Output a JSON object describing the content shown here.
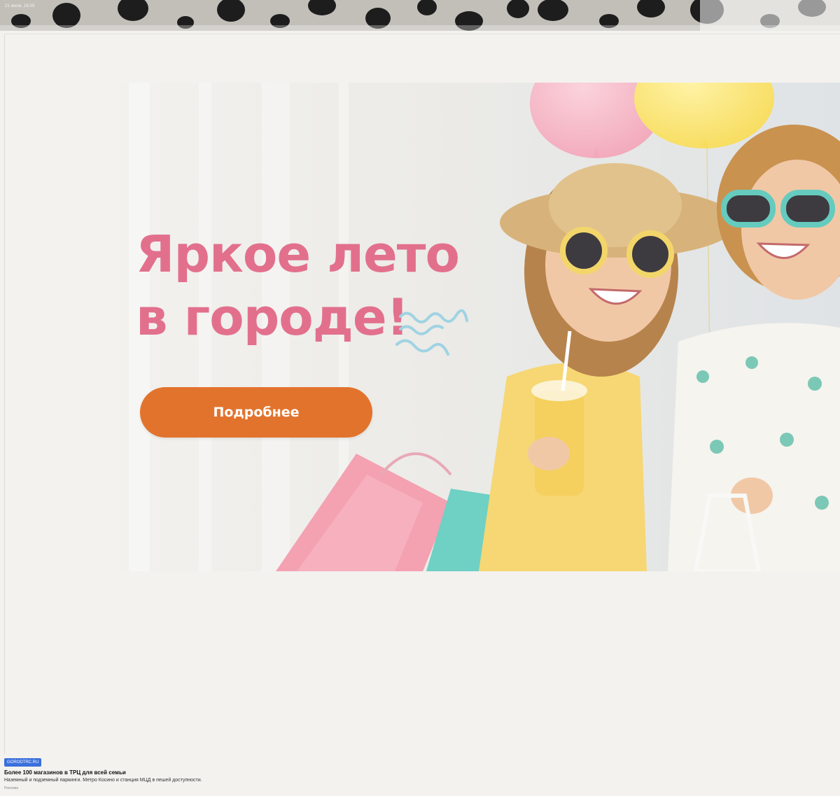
{
  "top_strip": {
    "timestamp": "21 июля, 16:05"
  },
  "banner": {
    "headline_line1": "Яркое лето",
    "headline_line2": "в городе!",
    "cta_label": "Подробнее",
    "colors": {
      "headline": "#e2708d",
      "cta": "#e2732d",
      "squiggle": "#9fd3e3"
    }
  },
  "footer": {
    "source": "GORODTRC.RU",
    "title": "Более 100 магазинов в ТРЦ для всей семьи",
    "description": "Наземный и подземный паркинги. Метро Косино и станция МЦД в пешей доступности.",
    "label": "Реклама"
  }
}
